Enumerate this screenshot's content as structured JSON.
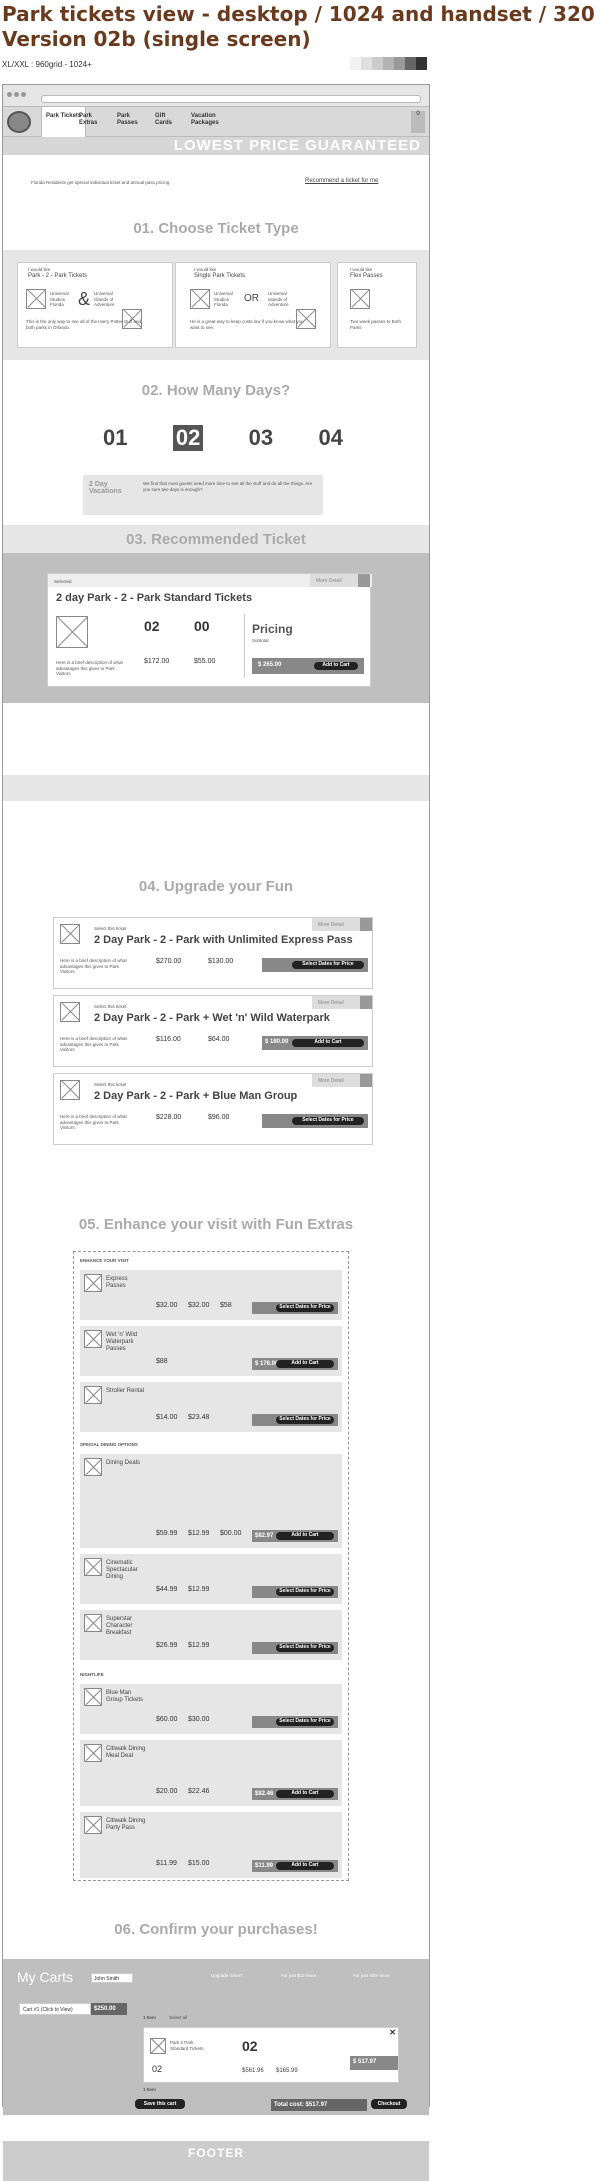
{
  "header": {
    "title": "Park tickets view - desktop / 1024 and handset / 320",
    "version": "Version 02b (single screen)",
    "grid": "XL/XXL : 960grid - 1024+"
  },
  "swatches": [
    "#f2f2f2",
    "#e0e0e0",
    "#cccccc",
    "#b3b3b3",
    "#999999",
    "#666666",
    "#333333"
  ],
  "nav": {
    "tabs": [
      "Park Tickets",
      "Park Extras",
      "Park Passes",
      "Gift Cards",
      "Vacation Packages"
    ],
    "cart_count": "0"
  },
  "banner": "LOWEST PRICE GUARANTEED",
  "intro": {
    "text": "Florida Residents get special individual ticket and annual pass pricing.",
    "recommend": "Recommend a ticket for me"
  },
  "steps": [
    "01. Choose Ticket Type",
    "02. How Many Days?",
    "03. Recommended Ticket",
    "04. Upgrade your Fun",
    "05. Enhance your visit with Fun Extras",
    "06. Confirm your purchases!"
  ],
  "ticket_types": [
    {
      "pre": "I would like",
      "name": "Park - 2 - Park Tickets",
      "a": "Universal Studios Florida",
      "b": "Universal Islands of Adventure",
      "join": "&",
      "desc": "This is the only way to see all of the Harry Potter stuff and both parks in Orlando."
    },
    {
      "pre": "I would like",
      "name": "Single Park Tickets",
      "a": "Universal Studios Florida",
      "b": "Universal Islands of Adventure",
      "join": "OR",
      "desc": "He is a great way to keep costs low if you know what you want to see."
    },
    {
      "pre": "I would like",
      "name": "Flex Passes",
      "a": "",
      "b": "",
      "join": "",
      "desc": "Two week passes to Both Parks"
    }
  ],
  "days": {
    "options": [
      "01",
      "02",
      "03",
      "04"
    ],
    "selected": "02",
    "label": "2 Day Vacations",
    "desc": "We find that most guests need more time to see all the stuff and do all the things. Are you sure two days is enough?"
  },
  "recommended": {
    "selected": "Selected",
    "title": "2 day Park - 2 - Park Standard Tickets",
    "adults": "02",
    "kids": "00",
    "adult_price": "$172.00",
    "kid_price": "$55.00",
    "pricing": "Pricing",
    "subtotal": "Subtotal",
    "total": "$ 265.00",
    "add": "Add to Cart",
    "more": "More Detail",
    "desc": "Here is a brief description of what advantages this gives to Park Visitors"
  },
  "upgrades": [
    {
      "title": "2 Day Park - 2 - Park with Unlimited Express Pass",
      "p1": "$270.00",
      "p2": "$130.00",
      "btn": "Select Dates for Price"
    },
    {
      "title": "2 Day Park - 2 - Park + Wet 'n' Wild Waterpark",
      "p1": "$116.00",
      "p2": "$64.00",
      "btn": "Add to Cart",
      "total": "$ 180.00"
    },
    {
      "title": "2 Day Park - 2 - Park + Blue Man Group",
      "p1": "$228.00",
      "p2": "$96.00",
      "btn": "Select Dates for Price"
    }
  ],
  "upgrade_common": {
    "select": "Select this ticket",
    "more": "More Detail",
    "desc": "Here is a brief description of what advantages this gives to Park Visitors"
  },
  "extras": {
    "enhance": "ENHANCE YOUR VISIT",
    "dining": "SPECIAL DINING OPTIONS",
    "nightlife": "NIGHTLIFE",
    "items": [
      {
        "name": "Express Passes",
        "p1": "$32.00",
        "p2": "$32.00",
        "p3": "$58",
        "btn": "Select Dates for Price"
      },
      {
        "name": "Wet 'n' Wild Waterpark Passes",
        "p1": "$88",
        "btn": "Add to Cart",
        "total": "$ 176.00"
      },
      {
        "name": "Stroller Rental",
        "p1": "$14.00",
        "p2": "$23.48",
        "btn": "Select Dates for Price"
      },
      {
        "name": "Dining Deals",
        "p1": "$59.99",
        "p2": "$12.99",
        "p3": "$00.00",
        "btn": "Add to Cart",
        "total": "$82.97"
      },
      {
        "name": "Cinematic Spectacular Dining",
        "p1": "$44.99",
        "p2": "$12.99",
        "btn": "Select Dates for Price"
      },
      {
        "name": "Superstar Character Breakfast",
        "p1": "$26.99",
        "p2": "$12.99",
        "btn": "Select Dates for Price"
      },
      {
        "name": "Blue Man Group Tickets",
        "p1": "$60.00",
        "p2": "$30.00",
        "btn": "Select Dates for Price"
      },
      {
        "name": "Citiwalk Dining Meal Deal",
        "p1": "$20.00",
        "p2": "$22.46",
        "btn": "Add to Cart",
        "total": "$82.46"
      },
      {
        "name": "Citiwalk Dining Party Pass",
        "p1": "$11.99",
        "p2": "$15.00",
        "btn": "Add to Cart",
        "total": "$11.99"
      }
    ]
  },
  "carts": {
    "title": "My Carts",
    "user": "John Smith",
    "cart_btn": "Cart #1 (Click to View)",
    "cart_total": "$250.00",
    "items": "1 Item",
    "select_all": "Select all",
    "item_name": "Park 2 Park Standard Tickets",
    "qty": "02",
    "p1": "$561.96",
    "p2": "$165.99",
    "item_total": "$ 517.97",
    "save": "Save this cart",
    "total": "Total cost: $517.97",
    "checkout": "Checkout",
    "up1": "Upgrade ticket?",
    "up2": "For just $12 more",
    "up3": "For just 40% more"
  },
  "footer": "FOOTER"
}
